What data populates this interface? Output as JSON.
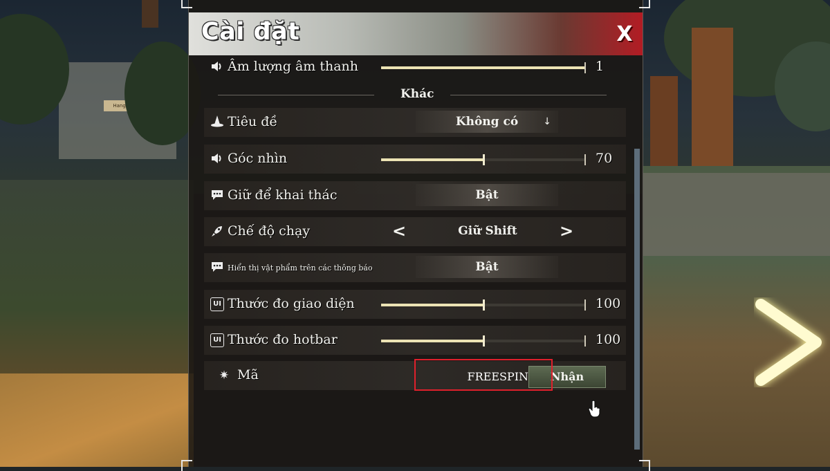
{
  "window": {
    "title": "Cài đặt",
    "close_label": "X"
  },
  "scene": {
    "sign_text": "Hang Động"
  },
  "rows": {
    "volume": {
      "label": "Âm lượng âm thanh",
      "value": "1",
      "fraction": 1.0
    },
    "section_other": {
      "label": "Khác"
    },
    "title": {
      "label": "Tiêu đề",
      "selected": "Không có",
      "arrow": "↓"
    },
    "fov": {
      "label": "Góc nhìn",
      "value": "70",
      "fraction": 0.5
    },
    "hold_to_mine": {
      "label": "Giữ để khai thác",
      "state": "Bật"
    },
    "sprint_mode": {
      "label": "Chế độ chạy",
      "selected": "Giữ Shift",
      "prev": "<",
      "next": ">"
    },
    "item_notifications": {
      "label": "Hiển thị vật phẩm trên các thông báo",
      "state": "Bật"
    },
    "ui_scale": {
      "label": "Thước đo giao diện",
      "value": "100",
      "fraction": 0.5
    },
    "hotbar_scale": {
      "label": "Thước đo hotbar",
      "value": "100",
      "fraction": 0.5
    },
    "code": {
      "label": "Mã",
      "input_value": "FREESPINS",
      "redeem_label": "Nhận"
    }
  },
  "icons": {
    "volume": "speaker-icon",
    "title": "witch-hat-icon",
    "fov": "speaker-icon",
    "hold_to_mine": "chat-bubble-icon",
    "sprint_mode": "rocket-icon",
    "item_notifications": "chat-bubble-icon",
    "ui_scale": "ui-badge-icon",
    "hotbar_scale": "ui-badge-icon",
    "code": "sparkle-icon",
    "ui_badge_text": "UI"
  },
  "colors": {
    "header_red": "#b21c24",
    "slider_fill": "#ece3b4",
    "highlight": "#e0202c",
    "redeem_bg": "#4c5844"
  }
}
